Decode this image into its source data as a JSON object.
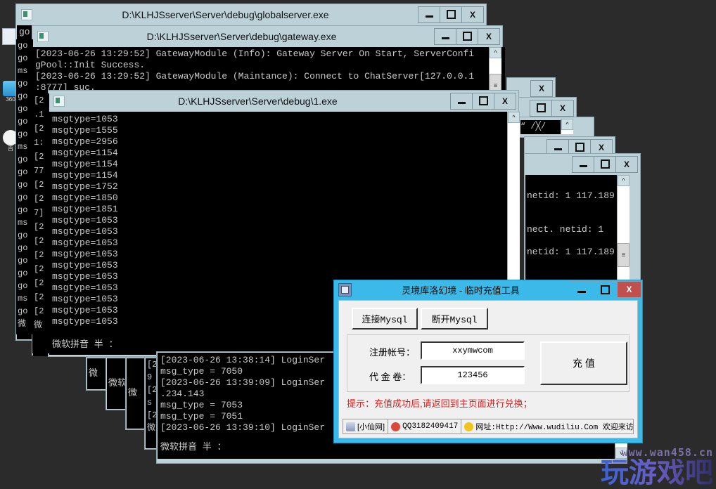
{
  "desktop": {
    "icons": [
      {
        "name": "file-icon",
        "label": "",
        "color": "#dfe6ee"
      },
      {
        "name": "360-icon",
        "label": "360",
        "color": "#2ea7e0"
      },
      {
        "name": "baidu-icon",
        "label": "百",
        "color": "#f0f0f0"
      }
    ]
  },
  "windows": {
    "globalserver": {
      "title": "D:\\KLHJSserver\\Server\\debug\\globalserver.exe",
      "lines": [
        "go",
        "go",
        "ms",
        "go",
        "go",
        "go",
        "go",
        "go",
        "ms",
        "go",
        "go",
        "go",
        "go",
        "go",
        "ms",
        "go",
        "go",
        "go",
        "go",
        "go",
        "ms",
        "go",
        "微"
      ]
    },
    "gateway": {
      "title": "D:\\KLHJSserver\\Server\\debug\\gateway.exe",
      "lines": [
        "[2023-06-26 13:29:52] GatewayModule (Info): Gateway Server On Start, ServerConfi",
        "gPool::Init Success.",
        "[2023-06-26 13:29:52] GatewayModule (Maintance): Connect to ChatServer[127.0.0.1",
        ":8777] suc."
      ],
      "side_lines": [
        "[2",
        ".1",
        "[2",
        "1:",
        "[2",
        "77",
        "[2",
        "[2",
        "7]",
        "[2",
        "[2",
        "[2",
        "[2",
        "[2",
        "[2",
        "[2",
        "微"
      ]
    },
    "one_exe": {
      "title": "D:\\KLHJSserver\\Server\\debug\\1.exe",
      "lines": [
        "msgtype=1053",
        "msgtype=1555",
        "msgtype=2956",
        "msgtype=1154",
        "msgtype=1154",
        "msgtype=1154",
        "msgtype=1752",
        "msgtype=1850",
        "msgtype=1851",
        "msgtype=1053",
        "msgtype=1053",
        "msgtype=1053",
        "msgtype=1053",
        "msgtype=1053",
        "msgtype=1053",
        "msgtype=1053",
        "msgtype=1053",
        "msgtype=1053",
        "msgtype=1053"
      ],
      "ime": "微软拼音 半 ："
    },
    "loginserver": {
      "lines": [
        "[2023-06-26 13:38:14] LoginSer",
        "msg_type = 7050",
        "[2023-06-26 13:39:09] LoginSer",
        ".234.143",
        "msg_type = 7053",
        "msg_type = 7051",
        "[2023-06-26 13:39:10] LoginSer"
      ],
      "ime": "微软拼音 半 ："
    },
    "netid_window": {
      "lines": [
        "netid: 1 117.189",
        "",
        "",
        "nect. netid: 1",
        "",
        "netid: 1 117.189"
      ]
    },
    "small_snippet": "“ /╳/",
    "cascade_ime": [
      "微",
      "微软拼",
      "微",
      "微"
    ],
    "side_col": [
      "[2",
      "9",
      "[2",
      "s",
      "[2",
      "微"
    ],
    "buttons": {
      "minimize": "–",
      "maximize": "□",
      "close": "X"
    }
  },
  "tool_dialog": {
    "title": "灵境库洛幻境 - 临时充值工具",
    "icon": "app-icon",
    "buttons": {
      "minimize": "–",
      "maximize": "□",
      "close": "X"
    },
    "connect_button": "连接Mysql",
    "disconnect_button": "断开Mysql",
    "account_label": "注册帐号：",
    "account_value": "xxymwcom",
    "voucher_label": "代 金 卷：",
    "voucher_value": "123456",
    "recharge_button": "充 值",
    "hint": "提示：充值成功后,请返回到主页面进行兑换；",
    "status": {
      "site": "[小仙网]",
      "qq": "QQ3182409417",
      "url": "网址:Http://Www.wudiliu.Com 欢迎来访"
    },
    "colors": {
      "title_bg": "#3bb9e8",
      "close_bg": "#c0504d",
      "hint": "#e02020"
    }
  },
  "watermark": {
    "line1": "www.wan458.cn",
    "line2": "玩游戏吧"
  }
}
